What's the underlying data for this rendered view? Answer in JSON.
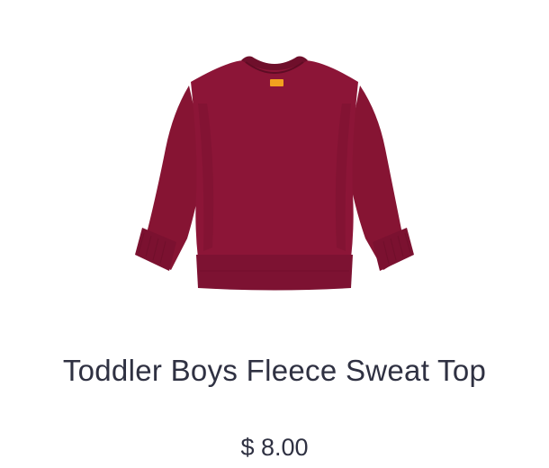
{
  "product": {
    "image_alt": "Toddler Boys Fleece Sweat Top",
    "image_colors": {
      "body": "#8c1537",
      "shade": "#6f0f2b",
      "rib": "#7d1232",
      "tag": "#f2a11f"
    },
    "title": "Toddler Boys Fleece Sweat Top",
    "price": "$ 8.00"
  }
}
